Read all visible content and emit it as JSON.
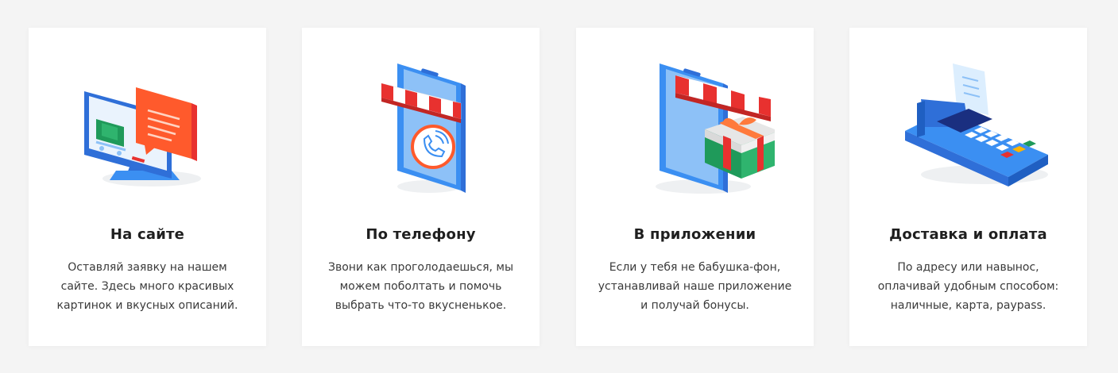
{
  "cards": [
    {
      "title": "На сайте",
      "lines": [
        "Оставляй заявку на нашем",
        "сайте. Здесь много красивых",
        "картинок и вкусных описаний."
      ],
      "icon": "computer-order-icon"
    },
    {
      "title": "По телефону",
      "lines": [
        "Звони как проголодаешься, мы",
        "можем поболтать и помочь",
        "выбрать что-то вкусненькое."
      ],
      "icon": "phone-call-icon"
    },
    {
      "title": "В приложении",
      "lines": [
        "Если у тебя не бабушка-фон,",
        "устанавливай наше приложение",
        "и получай бонусы."
      ],
      "icon": "app-gift-icon"
    },
    {
      "title": "Доставка и оплата",
      "lines": [
        "По адресу или навынос,",
        "оплачивай удобным способом:",
        "наличные, карта, paypass."
      ],
      "icon": "payment-terminal-icon"
    }
  ],
  "colors": {
    "blue": "#3b8ff2",
    "light_blue": "#8dc1f7",
    "red": "#e8312f",
    "orange": "#ff5a2c",
    "green": "#1f9a5a"
  }
}
